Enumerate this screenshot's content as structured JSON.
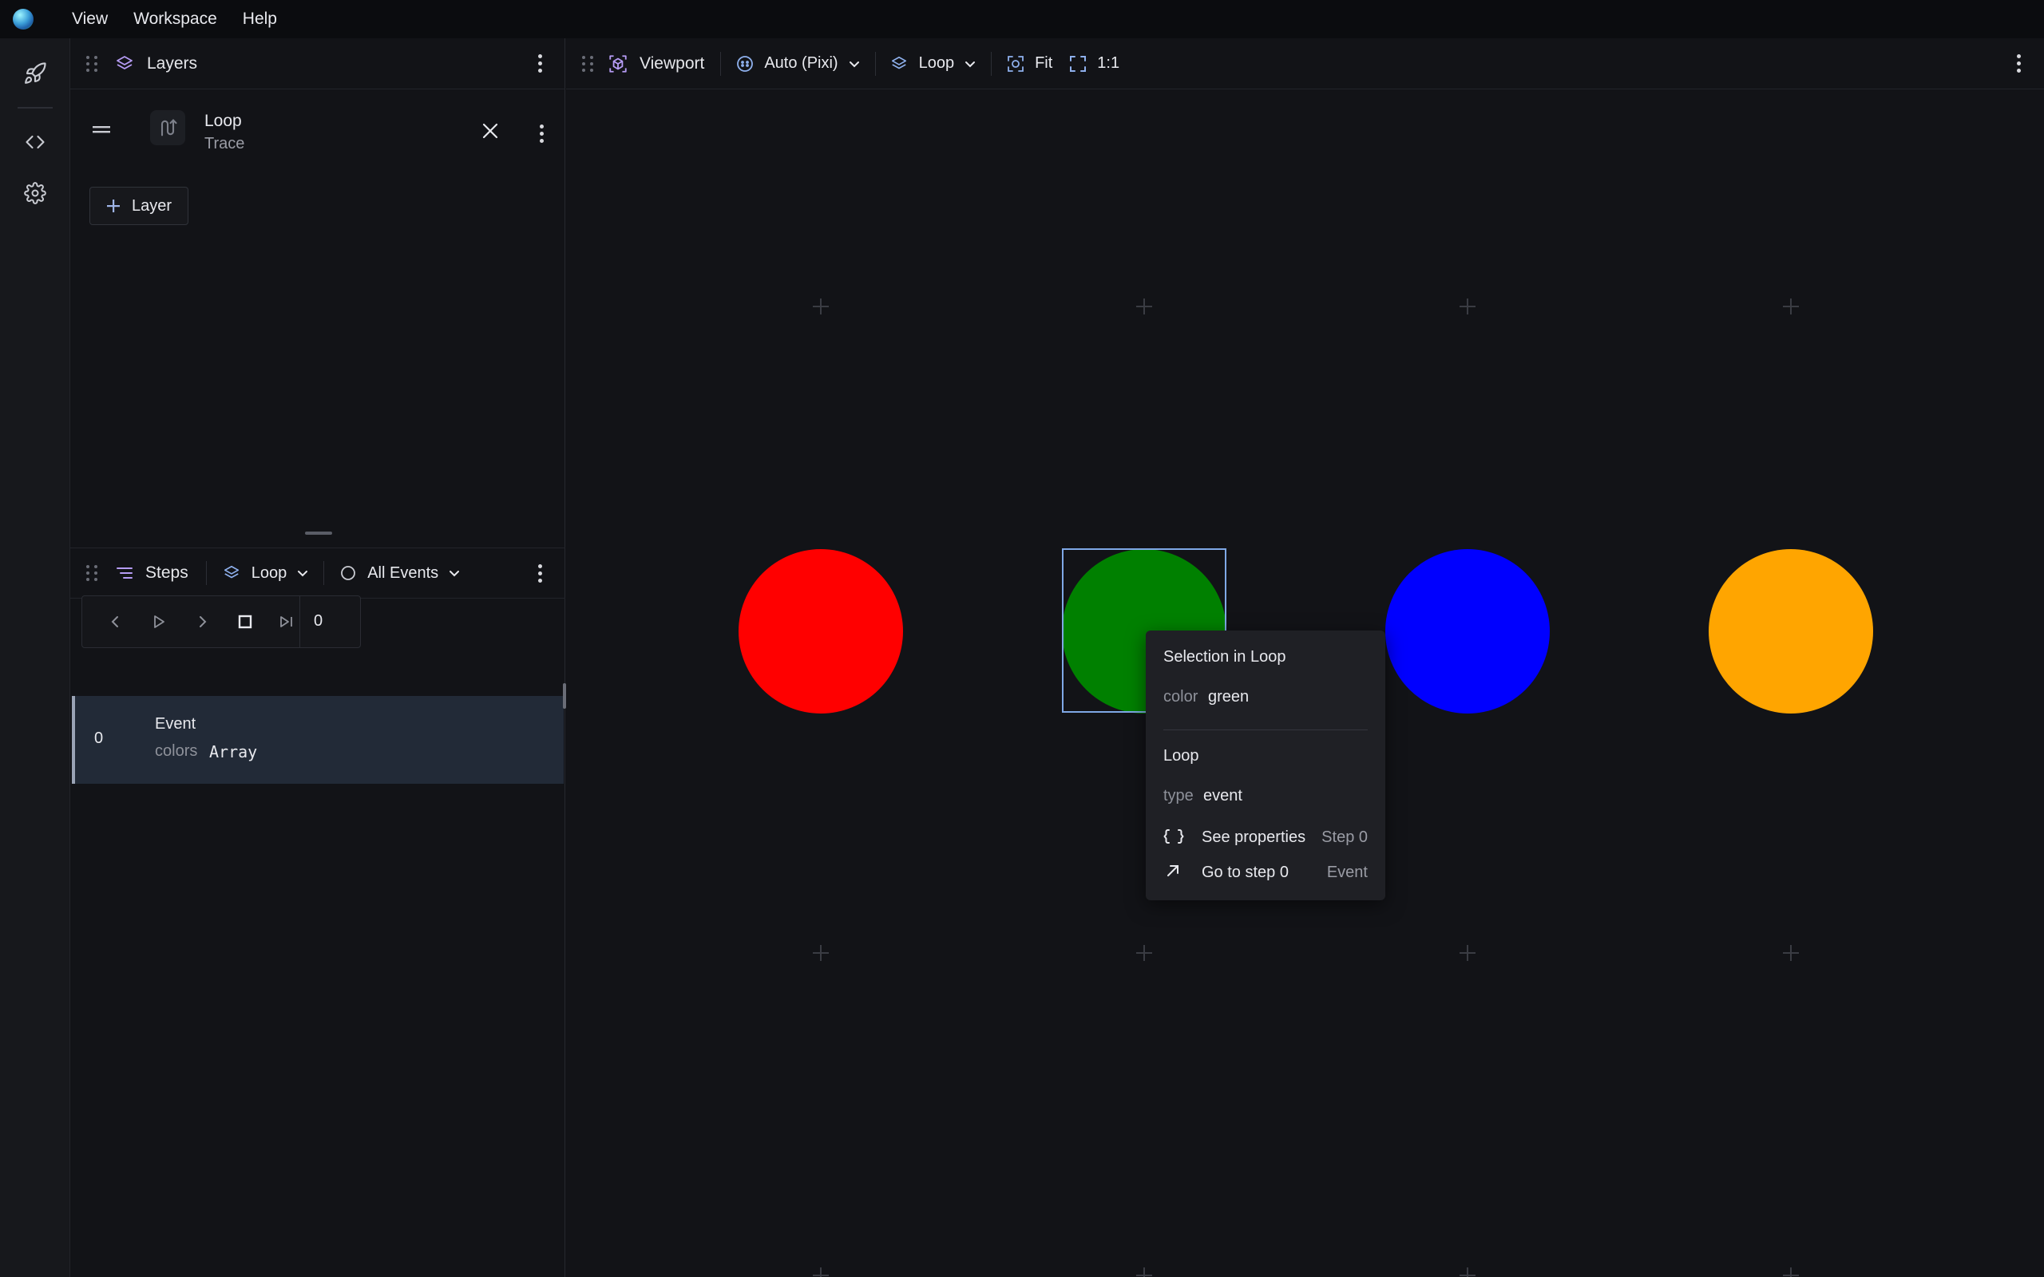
{
  "menu": {
    "items": [
      "View",
      "Workspace",
      "Help"
    ]
  },
  "activity": {
    "icons": [
      "rocket-icon",
      "code-icon",
      "settings-gear-icon"
    ]
  },
  "layers_panel": {
    "title": "Layers",
    "layer": {
      "name": "Loop",
      "type": "Trace"
    },
    "add_layer_label": "Layer"
  },
  "steps_panel": {
    "title": "Steps",
    "layer_select": "Loop",
    "event_filter": "All Events",
    "current_step": "0",
    "events": [
      {
        "index": "0",
        "name": "Event",
        "key": "colors",
        "value": "Array"
      }
    ]
  },
  "viewport": {
    "title": "Viewport",
    "renderer": "Auto (Pixi)",
    "layer_select": "Loop",
    "fit_label": "Fit",
    "zoom_label": "1:1",
    "circles": [
      {
        "name": "red",
        "color": "#ff0000"
      },
      {
        "name": "green",
        "color": "#008000"
      },
      {
        "name": "blue",
        "color": "#0000ff"
      },
      {
        "name": "orange",
        "color": "#ffa500"
      }
    ],
    "selection_color": "#7fa8e6"
  },
  "popup": {
    "title": "Selection in Loop",
    "color_key": "color",
    "color_value": "green",
    "section": "Loop",
    "type_key": "type",
    "type_value": "event",
    "see_properties": "See properties",
    "see_properties_meta": "Step 0",
    "go_to_step": "Go to step 0",
    "go_to_step_meta": "Event"
  }
}
